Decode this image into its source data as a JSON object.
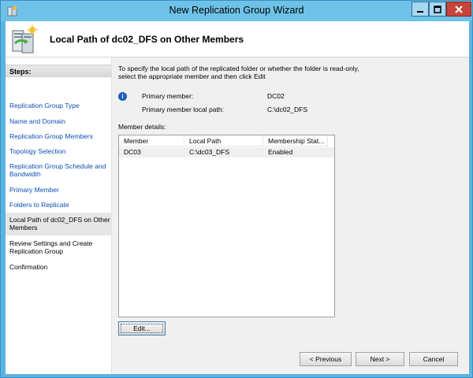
{
  "window": {
    "title": "New Replication Group Wizard",
    "icon": "replication-wizard-icon"
  },
  "header": {
    "title": "Local Path of dc02_DFS on Other Members"
  },
  "steps": {
    "title": "Steps:",
    "items": [
      {
        "label": "Replication Group Type"
      },
      {
        "label": "Name and Domain"
      },
      {
        "label": "Replication Group Members"
      },
      {
        "label": "Topology Selection"
      },
      {
        "label": "Replication Group Schedule and Bandwidth"
      },
      {
        "label": "Primary Member"
      },
      {
        "label": "Folders to Replicate"
      },
      {
        "label": "Local Path of dc02_DFS on Other Members"
      },
      {
        "label": "Review Settings and Create Replication Group"
      },
      {
        "label": "Confirmation"
      }
    ]
  },
  "content": {
    "intro_line1": "To specify the local path of the replicated folder or whether the folder is read-only,",
    "intro_line2": "select the appropriate member and then click Edit",
    "primary_member_label": "Primary member:",
    "primary_member_value": "DC02",
    "primary_path_label": "Primary member local path:",
    "primary_path_value": "C:\\dc02_DFS",
    "member_details_label": "Member details:",
    "columns": [
      "Member",
      "Local Path",
      "Membership Stat..."
    ],
    "rows": [
      {
        "member": "DC03",
        "local_path": "C:\\dc03_DFS",
        "status": "Enabled"
      }
    ]
  },
  "buttons": {
    "edit": "Edit...",
    "previous": "< Previous",
    "next": "Next >",
    "cancel": "Cancel"
  }
}
